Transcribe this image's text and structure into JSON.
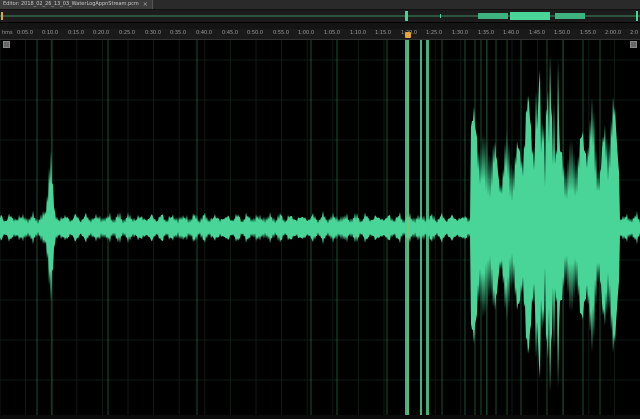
{
  "tab": {
    "title": "Editor: 2018_02_26_13_03_WaterLogAppnStream.pcm",
    "close_icon": "×"
  },
  "ruler": {
    "unit": "hms",
    "ticks": [
      "0:05.0",
      "0:10.0",
      "0:15.0",
      "0:20.0",
      "0:25.0",
      "0:30.0",
      "0:35.0",
      "0:40.0",
      "0:45.0",
      "0:50.0",
      "0:55.0",
      "1:00.0",
      "1:05.0",
      "1:10.0",
      "1:15.0",
      "1:20.0",
      "1:25.0",
      "1:30.0",
      "1:35.0",
      "1:40.0",
      "1:45.0",
      "1:50.0",
      "1:55.0",
      "2:00.0",
      "2:0"
    ]
  },
  "colors": {
    "waveform": "#48d597",
    "marker_line": "#2f8f58",
    "playhead": "#e3a53a",
    "background": "#000000"
  },
  "icons": {
    "corner_button_left": "square-icon",
    "corner_button_right": "square-icon"
  }
}
